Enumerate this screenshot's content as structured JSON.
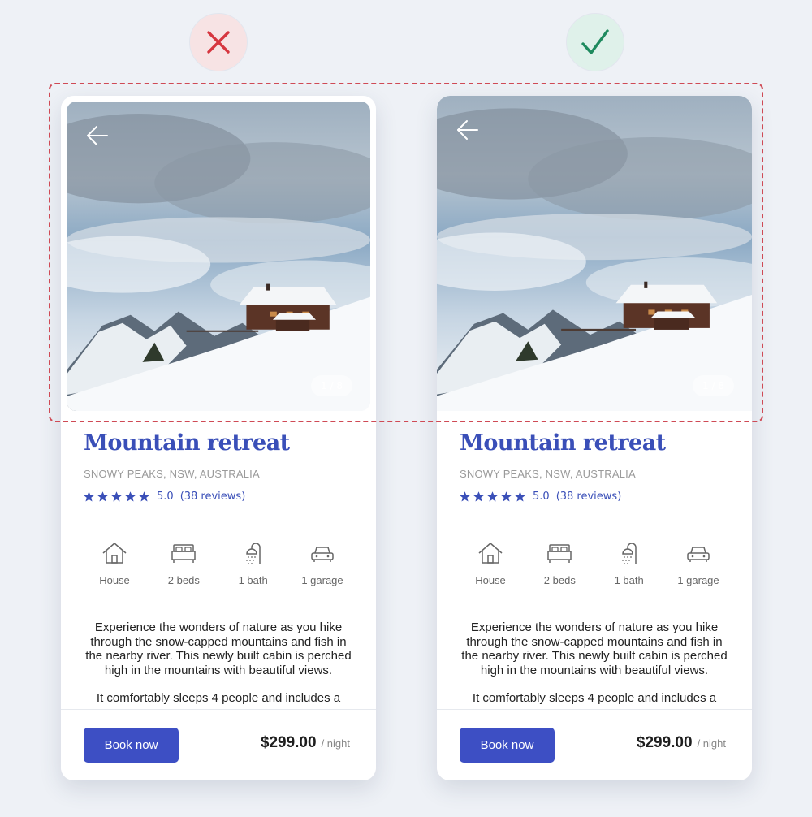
{
  "verdicts": {
    "bad": {
      "icon": "cross-mark-icon",
      "color": "#d6363f"
    },
    "good": {
      "icon": "check-mark-icon",
      "color": "#1e8a5e"
    }
  },
  "cards": [
    {
      "variant": "incorrect",
      "photo_counter": "1 / 8",
      "title": "Mountain retreat",
      "location": "SNOWY PEAKS, NSW, AUSTRALIA",
      "rating_value": "5.0",
      "reviews": "(38 reviews)",
      "stars": 5,
      "features": [
        {
          "icon": "house-icon",
          "label": "House"
        },
        {
          "icon": "bed-icon",
          "label": "2 beds"
        },
        {
          "icon": "shower-icon",
          "label": "1 bath"
        },
        {
          "icon": "car-icon",
          "label": "1 garage"
        }
      ],
      "description": [
        "Experience the wonders of nature as you hike through the snow-capped mountains and fish in the nearby river. This newly built cabin is perched high in the mountains with beautiful views.",
        "It comfortably sleeps 4 people and includes a"
      ],
      "book_label": "Book now",
      "price": "$299.00",
      "price_unit": "/ night"
    },
    {
      "variant": "correct",
      "photo_counter": "1 / 8",
      "title": "Mountain retreat",
      "location": "SNOWY PEAKS, NSW, AUSTRALIA",
      "rating_value": "5.0",
      "reviews": "(38 reviews)",
      "stars": 5,
      "features": [
        {
          "icon": "house-icon",
          "label": "House"
        },
        {
          "icon": "bed-icon",
          "label": "2 beds"
        },
        {
          "icon": "shower-icon",
          "label": "1 bath"
        },
        {
          "icon": "car-icon",
          "label": "1 garage"
        }
      ],
      "description": [
        "Experience the wonders of nature as you hike through the snow-capped mountains and fish in the nearby river. This newly built cabin is perched high in the mountains with beautiful views.",
        "It comfortably sleeps 4 people and includes a"
      ],
      "book_label": "Book now",
      "price": "$299.00",
      "price_unit": "/ night"
    }
  ],
  "colors": {
    "accent": "#3a4fb8",
    "button": "#3d4fc4",
    "highlight_border": "#cf4a55"
  }
}
